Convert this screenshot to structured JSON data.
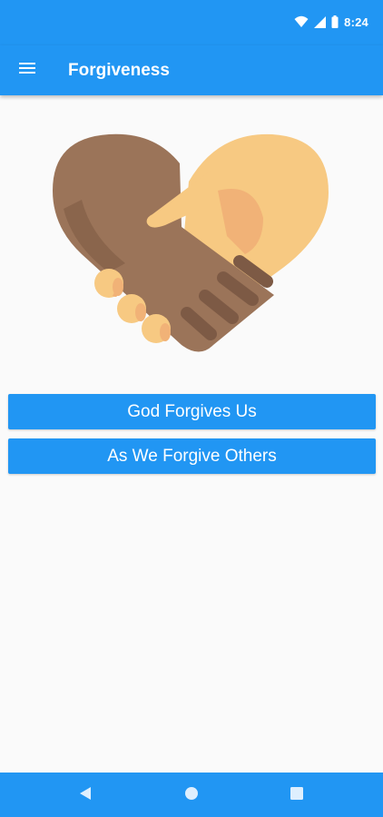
{
  "status_bar": {
    "time": "8:24",
    "icons": [
      "wifi-icon",
      "cellular-signal-icon",
      "battery-icon"
    ]
  },
  "app_bar": {
    "title": "Forgiveness",
    "menu_icon": "hamburger-menu-icon"
  },
  "hero": {
    "image": "heart-handshake-illustration"
  },
  "buttons": {
    "god_forgives": "God Forgives Us",
    "forgive_others": "As We Forgive Others"
  },
  "nav_bar": {
    "icons": [
      "back-icon",
      "home-icon",
      "recent-apps-icon"
    ]
  },
  "colors": {
    "primary": "#2196F3",
    "background": "#FAFAFA",
    "skin_dark": "#9B7459",
    "skin_dark_shade": "#7D5A45",
    "skin_light": "#F7C982",
    "skin_light_shade": "#F1B277"
  }
}
